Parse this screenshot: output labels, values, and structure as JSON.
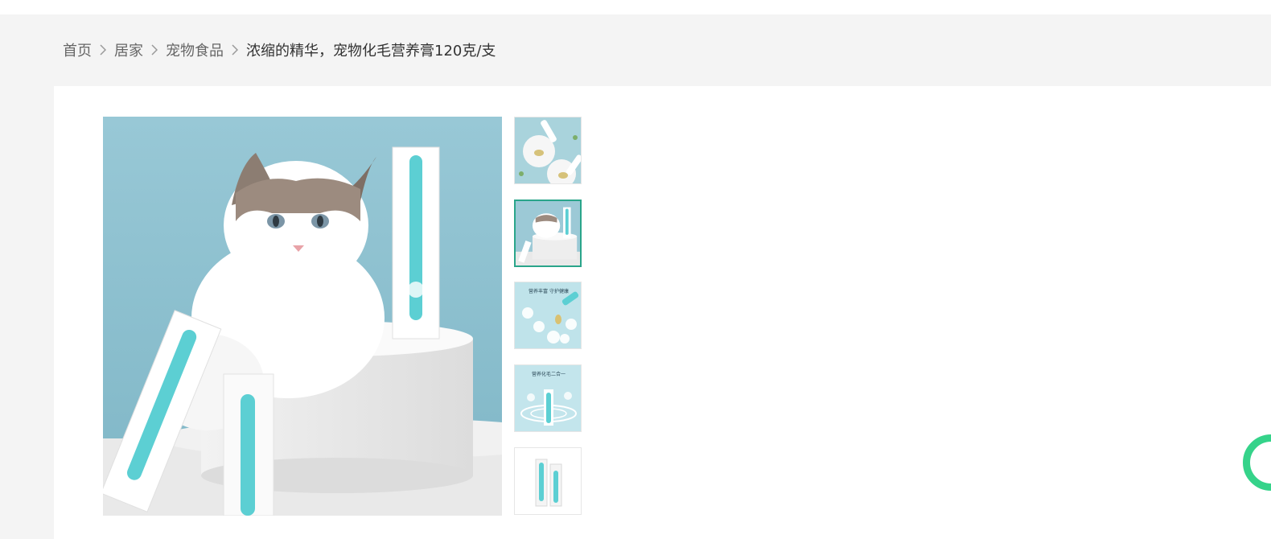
{
  "breadcrumb": {
    "items": [
      "首页",
      "居家",
      "宠物食品"
    ],
    "current": "浓缩的精华，宠物化毛营养膏120克/支"
  },
  "gallery": {
    "selected_index": 1,
    "thumbnails": [
      "thumb-bowls",
      "thumb-cat-product",
      "thumb-nutrition",
      "thumb-hairball",
      "thumb-packaging"
    ],
    "thumb_texts": {
      "nutrition_title": "营养丰富 守护健康",
      "hairball_title": "营养化毛二合一"
    }
  },
  "colors": {
    "accent": "#2aa58a",
    "product_teal": "#5ccfd3",
    "background_blue": "#9cc9d6",
    "floating_button": "#35d38a"
  }
}
